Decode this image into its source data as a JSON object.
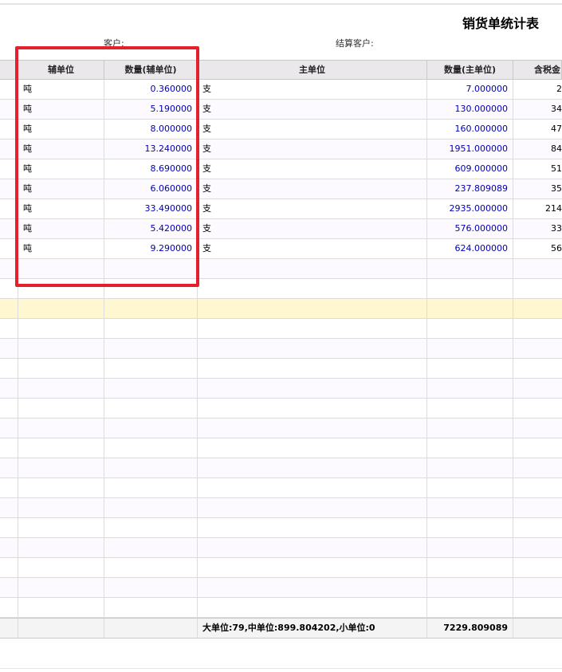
{
  "report": {
    "title": "销货单统计表",
    "customer_label": "客户:",
    "settle_customer_label": "结算客户:"
  },
  "table": {
    "columns": [
      "",
      "辅单位",
      "数量(辅单位)",
      "主单位",
      "数量(主单位)",
      "含税金"
    ],
    "rows": [
      {
        "aux_unit": "吨",
        "aux_qty": "0.360000",
        "main_unit": "支",
        "main_qty": "7.000000",
        "amount": "2"
      },
      {
        "aux_unit": "吨",
        "aux_qty": "5.190000",
        "main_unit": "支",
        "main_qty": "130.000000",
        "amount": "34"
      },
      {
        "aux_unit": "吨",
        "aux_qty": "8.000000",
        "main_unit": "支",
        "main_qty": "160.000000",
        "amount": "47"
      },
      {
        "aux_unit": "吨",
        "aux_qty": "13.240000",
        "main_unit": "支",
        "main_qty": "1951.000000",
        "amount": "84"
      },
      {
        "aux_unit": "吨",
        "aux_qty": "8.690000",
        "main_unit": "支",
        "main_qty": "609.000000",
        "amount": "51"
      },
      {
        "aux_unit": "吨",
        "aux_qty": "6.060000",
        "main_unit": "支",
        "main_qty": "237.809089",
        "amount": "35"
      },
      {
        "aux_unit": "吨",
        "aux_qty": "33.490000",
        "main_unit": "支",
        "main_qty": "2935.000000",
        "amount": "214"
      },
      {
        "aux_unit": "吨",
        "aux_qty": "5.420000",
        "main_unit": "支",
        "main_qty": "576.000000",
        "amount": "33"
      },
      {
        "aux_unit": "吨",
        "aux_qty": "9.290000",
        "main_unit": "支",
        "main_qty": "624.000000",
        "amount": "56"
      }
    ],
    "total": {
      "summary": "大单位:79,中单位:899.804202,小单位:0",
      "main_qty_total": "7229.809089"
    }
  },
  "annotation": {
    "box_color": "#e5202e"
  }
}
